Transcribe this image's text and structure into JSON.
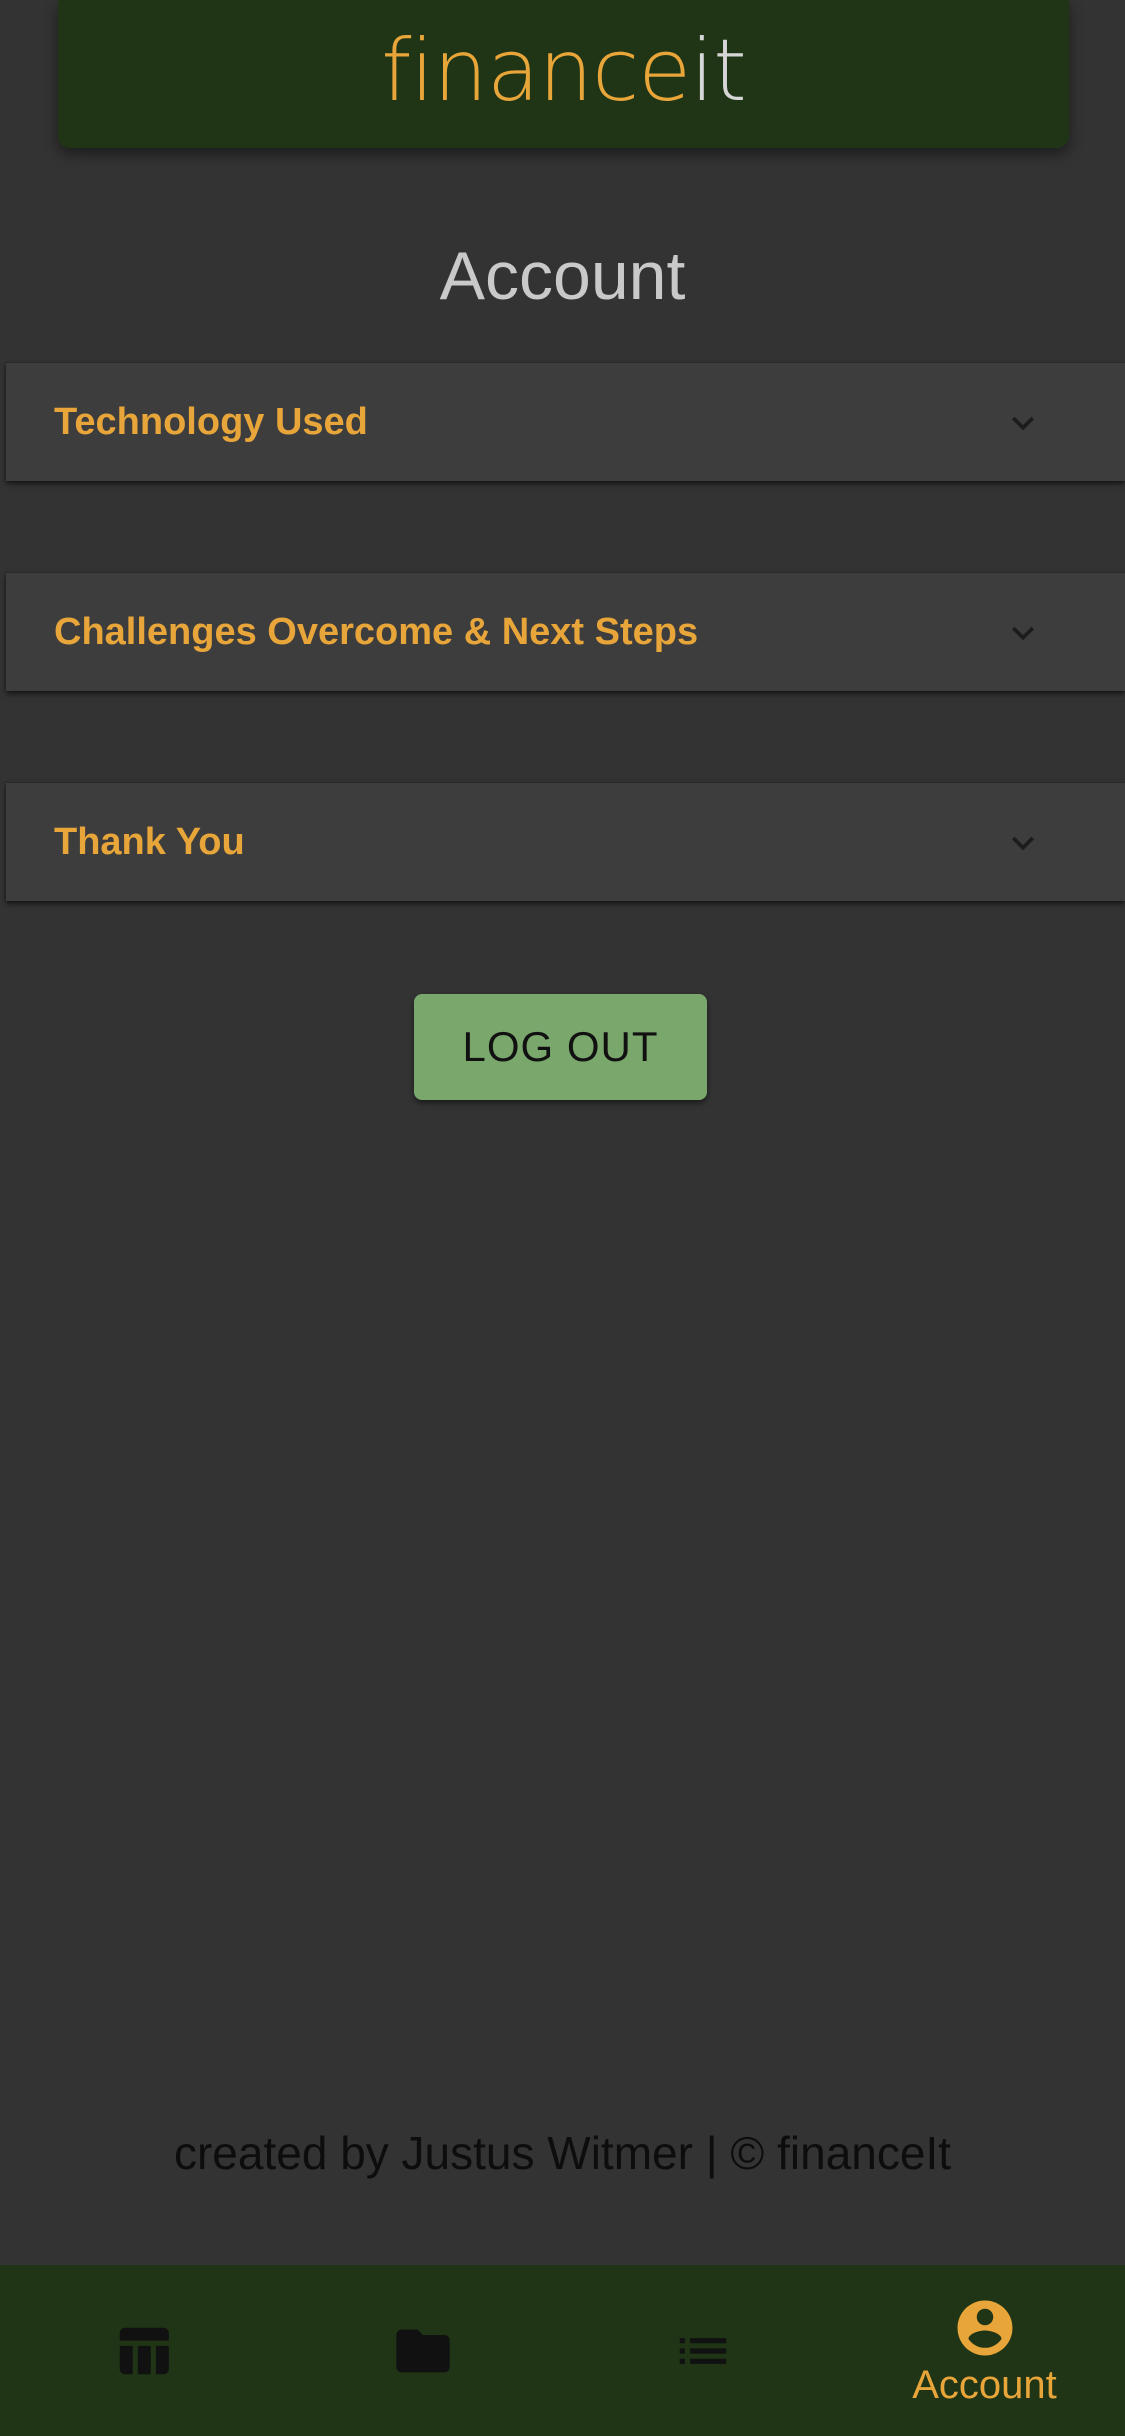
{
  "header": {
    "logo_part_1": "finance",
    "logo_part_2": "it"
  },
  "page": {
    "title": "Account"
  },
  "accordions": [
    {
      "label": "Technology Used",
      "icon": "chevron-down-icon",
      "expanded": false
    },
    {
      "label": "Challenges Overcome & Next Steps",
      "icon": "chevron-down-icon",
      "expanded": false
    },
    {
      "label": "Thank You",
      "icon": "chevron-down-icon",
      "expanded": false
    }
  ],
  "actions": {
    "logout_label": "LOG OUT"
  },
  "footer": {
    "credit": "created by Justus Witmer | © financeIt"
  },
  "bottom_nav": {
    "items": [
      {
        "icon": "table-icon",
        "label": "",
        "active": false
      },
      {
        "icon": "folder-icon",
        "label": "",
        "active": false
      },
      {
        "icon": "list-icon",
        "label": "",
        "active": false
      },
      {
        "icon": "account-circle-icon",
        "label": "Account",
        "active": true
      }
    ]
  },
  "colors": {
    "background": "#333333",
    "header_green": "#1f3515",
    "accent_orange": "#e8a53a",
    "button_green": "#7aa86c",
    "card_background": "#3d3d3d",
    "inactive_icon": "#111111"
  }
}
